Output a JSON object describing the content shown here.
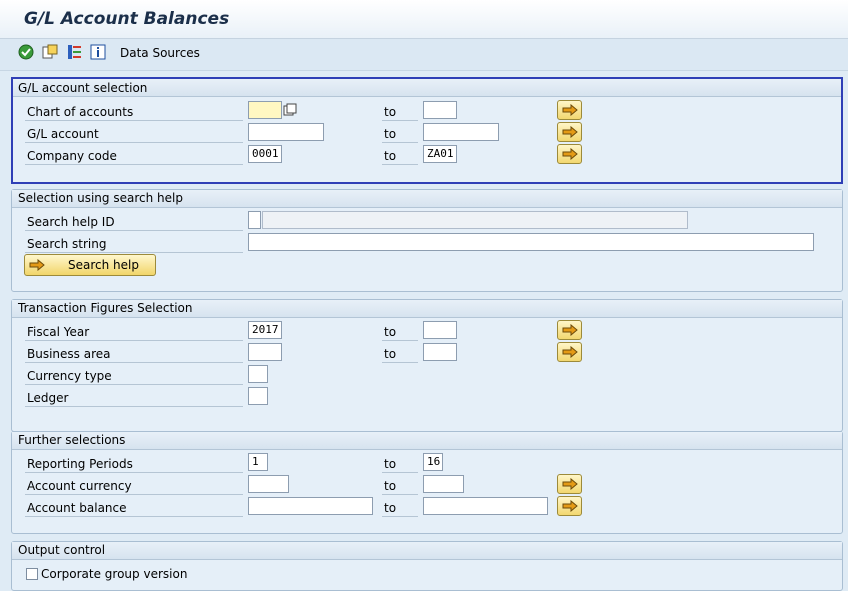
{
  "header": {
    "title": "G/L Account Balances"
  },
  "toolbar": {
    "icons": [
      "execute-icon",
      "variant-icon",
      "selection-options-icon",
      "info-icon"
    ],
    "data_sources_label": "Data Sources"
  },
  "to_label": "to",
  "gl_selection": {
    "title": "G/L account selection",
    "chart_of_accounts": {
      "label": "Chart of accounts",
      "from": "",
      "to": ""
    },
    "gl_account": {
      "label": "G/L account",
      "from": "",
      "to": ""
    },
    "company_code": {
      "label": "Company code",
      "from": "0001",
      "to": "ZA01"
    }
  },
  "search_help": {
    "title": "Selection using search help",
    "search_help_id": {
      "label": "Search help ID",
      "value": "",
      "desc": ""
    },
    "search_string": {
      "label": "Search string",
      "value": ""
    },
    "button_label": "Search help"
  },
  "transaction_figures": {
    "title": "Transaction Figures Selection",
    "fiscal_year": {
      "label": "Fiscal Year",
      "from": "2017",
      "to": ""
    },
    "business_area": {
      "label": "Business area",
      "from": "",
      "to": ""
    },
    "currency_type": {
      "label": "Currency type",
      "value": ""
    },
    "ledger": {
      "label": "Ledger",
      "value": ""
    }
  },
  "further_selections": {
    "title": "Further selections",
    "reporting_periods": {
      "label": "Reporting Periods",
      "from": "1",
      "to": "16"
    },
    "account_currency": {
      "label": "Account currency",
      "from": "",
      "to": ""
    },
    "account_balance": {
      "label": "Account balance",
      "from": "",
      "to": ""
    }
  },
  "output_control": {
    "title": "Output control",
    "corporate_group_version": {
      "label": "Corporate group version",
      "checked": false
    }
  },
  "colors": {
    "accent_border": "#2f3fb6",
    "button_yellow": "#f2d770",
    "background": "#dfebf5"
  }
}
